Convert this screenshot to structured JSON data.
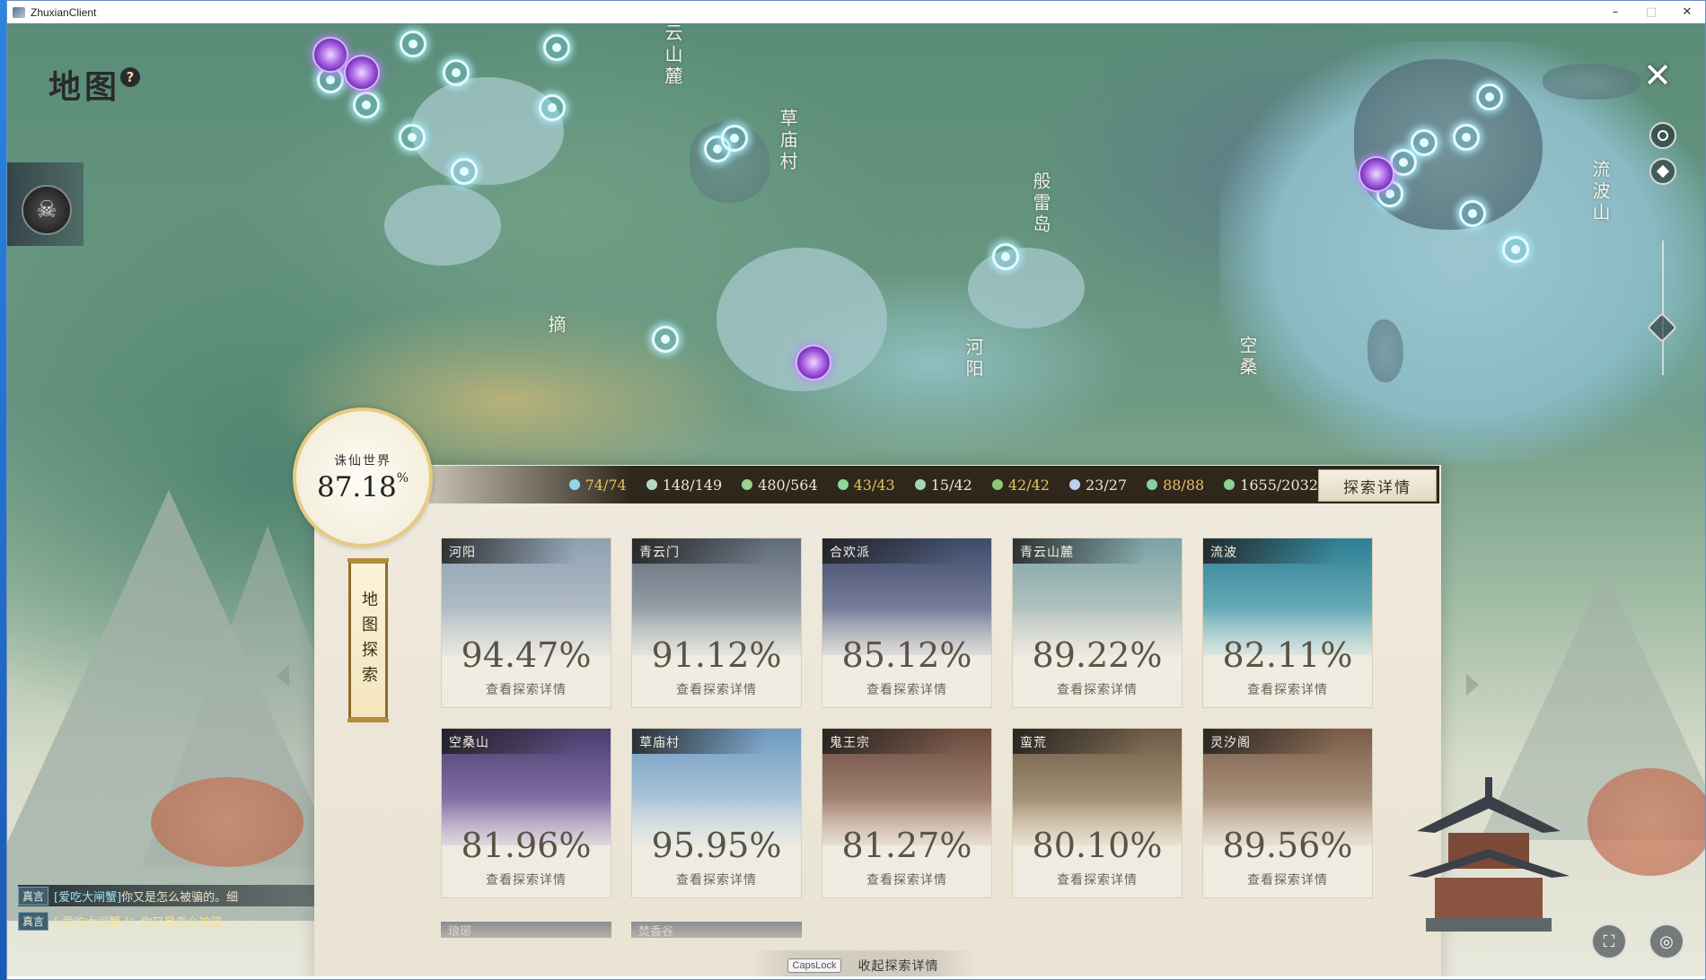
{
  "window": {
    "title": "ZhuxianClient",
    "minimize": "–",
    "maximize": "□",
    "close": "✕"
  },
  "map": {
    "title": "地图",
    "help_icon": "question-icon",
    "close_label": "✕"
  },
  "regions": [
    "云山麓",
    "草庙村",
    "般雷岛",
    "流波山",
    "河阳",
    "空桑",
    "摘"
  ],
  "world": {
    "name": "诛仙世界",
    "percent": "87.18",
    "percent_sign": "%"
  },
  "scroll_label": "地图探索",
  "stats": [
    {
      "icon": "waypoint-icon",
      "value": "74/74",
      "gold": true,
      "color": "#8fd7ea"
    },
    {
      "icon": "statue-icon",
      "value": "148/149",
      "gold": false,
      "color": "#b7d7c9"
    },
    {
      "icon": "leaf-icon",
      "value": "480/564",
      "gold": false,
      "color": "#9ad28f"
    },
    {
      "icon": "spirit-icon",
      "value": "43/43",
      "gold": true,
      "color": "#8ed79a"
    },
    {
      "icon": "swirl-icon",
      "value": "15/42",
      "gold": false,
      "color": "#a6d6b8"
    },
    {
      "icon": "herb-icon",
      "value": "42/42",
      "gold": true,
      "color": "#8cc97d"
    },
    {
      "icon": "bird-icon",
      "value": "23/27",
      "gold": false,
      "color": "#b8d2f0"
    },
    {
      "icon": "scroll-icon",
      "value": "88/88",
      "gold": true,
      "color": "#88cfa3"
    },
    {
      "icon": "fruit-icon",
      "value": "1655/2032",
      "gold": false,
      "color": "#8fd094"
    }
  ],
  "detail_button": "探索详情",
  "view_details": "查看探索详情",
  "areas": [
    {
      "name": "河阳",
      "percent": "94.47%",
      "c1": "#8ea1b2",
      "c2": "#c8cdd3"
    },
    {
      "name": "青云门",
      "percent": "91.12%",
      "c1": "#5f6b78",
      "c2": "#b7bfc4"
    },
    {
      "name": "合欢派",
      "percent": "85.12%",
      "c1": "#3d4a6a",
      "c2": "#9d9fb8"
    },
    {
      "name": "青云山麓",
      "percent": "89.22%",
      "c1": "#7aa2a6",
      "c2": "#d6d8cf"
    },
    {
      "name": "流波",
      "percent": "82.11%",
      "c1": "#2e7e93",
      "c2": "#8cc7cf"
    },
    {
      "name": "空桑山",
      "percent": "81.96%",
      "c1": "#4b3d6e",
      "c2": "#a48fc8"
    },
    {
      "name": "草庙村",
      "percent": "95.95%",
      "c1": "#6f9ac2",
      "c2": "#cfe0e6"
    },
    {
      "name": "鬼王宗",
      "percent": "81.27%",
      "c1": "#6b4b3e",
      "c2": "#c4a593"
    },
    {
      "name": "蛮荒",
      "percent": "80.10%",
      "c1": "#6c5a45",
      "c2": "#c8b595"
    },
    {
      "name": "灵汐阁",
      "percent": "89.56%",
      "c1": "#7a5c47",
      "c2": "#c9b5a0"
    }
  ],
  "peek_cards": [
    "琅琊",
    "焚香谷"
  ],
  "collapse": {
    "key": "CapsLock",
    "label": "收起探索详情"
  },
  "chat": [
    {
      "tag": "真言",
      "name": "[爱吃大闸蟹]",
      "text": "你又是怎么被骗的。细"
    },
    {
      "tag": "真言",
      "name": "[ 爱吃大闸蟹 ]",
      "text": "：你又是怎么被骗"
    }
  ],
  "icons": {
    "left_avatar": "demon-mask-icon",
    "side_tools": [
      "compass-icon",
      "location-pin-icon",
      "diamond-icon"
    ],
    "bottom_right": [
      "fullscreen-icon",
      "locate-icon"
    ]
  }
}
